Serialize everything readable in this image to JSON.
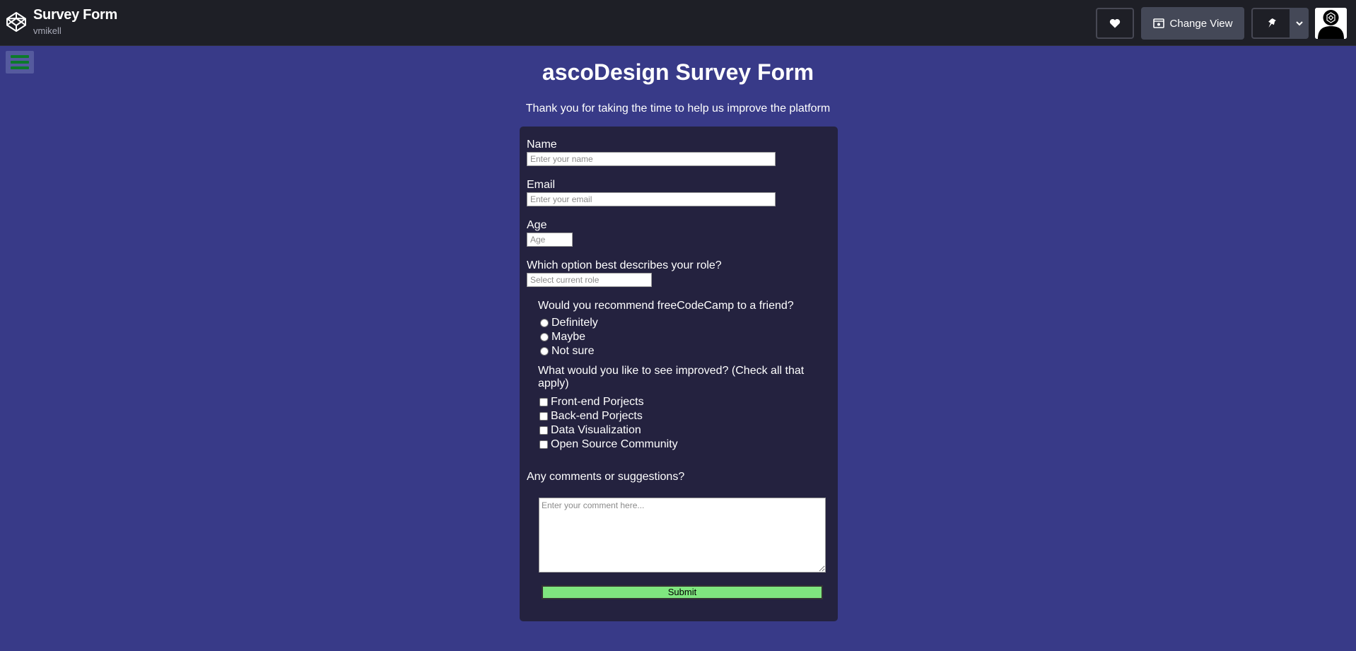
{
  "header": {
    "pen_title": "Survey Form",
    "pen_author": "vmikell",
    "change_view_label": "Change View",
    "logo_icon": "codepen-logo-icon",
    "like_icon": "heart-icon",
    "view_icon": "eye-window-icon",
    "pin_icon": "pin-icon",
    "caret_icon": "chevron-down-icon"
  },
  "colors": {
    "page_bg": "#383a88",
    "card_bg": "#24223f",
    "topbar_bg": "#1e1f26",
    "submit_bg": "#7fe67f",
    "hamburger_bars": "#0c7a2a"
  },
  "page": {
    "title": "ascoDesign Survey Form",
    "description": "Thank you for taking the time to help us improve the platform"
  },
  "form": {
    "name_label": "Name",
    "name_placeholder": "Enter your name",
    "email_label": "Email",
    "email_placeholder": "Enter your email",
    "age_label": "Age",
    "age_placeholder": "Age",
    "role_label": "Which option best describes your role?",
    "role_placeholder": "Select current role",
    "recommend_question": "Would you recommend freeCodeCamp to a friend?",
    "recommend_options": [
      "Definitely",
      "Maybe",
      "Not sure"
    ],
    "improve_question": "What would you like to see improved? (Check all that apply)",
    "improve_options": [
      "Front-end Porjects",
      "Back-end Porjects",
      "Data Visualization",
      "Open Source Community"
    ],
    "comments_label": "Any comments or suggestions?",
    "comments_placeholder": "Enter your comment here...",
    "submit_label": "Submit"
  }
}
